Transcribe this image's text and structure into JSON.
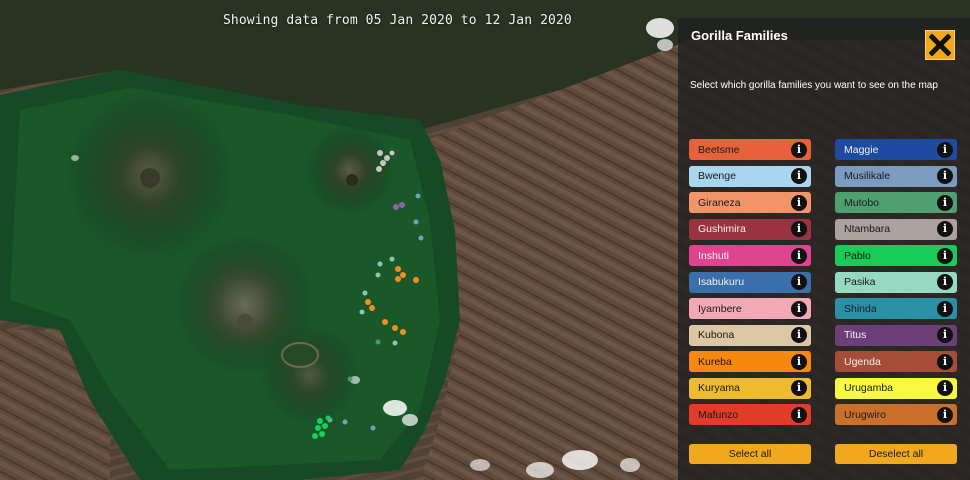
{
  "header": {
    "date_range": "Showing data from 05 Jan 2020 to 12 Jan 2020"
  },
  "panel": {
    "title": "Gorilla Families",
    "close_icon": "close-icon",
    "description": "Select which gorilla families you want to see on the map",
    "families_left": [
      {
        "name": "Beetsme",
        "color": "#e8613c",
        "text_color": "#1a1a1a"
      },
      {
        "name": "Bwenge",
        "color": "#a9d6ef",
        "text_color": "#1a1a1a"
      },
      {
        "name": "Giraneza",
        "color": "#f19468",
        "text_color": "#1a1a1a"
      },
      {
        "name": "Gushimira",
        "color": "#9a3340",
        "text_color": "#f2f2f2"
      },
      {
        "name": "Inshuti",
        "color": "#e04490",
        "text_color": "#f2f2f2"
      },
      {
        "name": "Isabukuru",
        "color": "#3a6fab",
        "text_color": "#f2f2f2"
      },
      {
        "name": "Iyambere",
        "color": "#f2a9b4",
        "text_color": "#1a1a1a"
      },
      {
        "name": "Kubona",
        "color": "#dcc6a3",
        "text_color": "#1a1a1a"
      },
      {
        "name": "Kureba",
        "color": "#f88710",
        "text_color": "#1a1a1a"
      },
      {
        "name": "Kuryama",
        "color": "#eebb30",
        "text_color": "#1a1a1a"
      },
      {
        "name": "Mafunzo",
        "color": "#e23b28",
        "text_color": "#1a1a1a"
      }
    ],
    "families_right": [
      {
        "name": "Maggie",
        "color": "#1e4aa0",
        "text_color": "#f2f2f2"
      },
      {
        "name": "Musilikale",
        "color": "#7c9bc0",
        "text_color": "#1a1a1a"
      },
      {
        "name": "Mutobo",
        "color": "#4fa06e",
        "text_color": "#1a1a1a"
      },
      {
        "name": "Ntambara",
        "color": "#aba2a0",
        "text_color": "#1a1a1a"
      },
      {
        "name": "Pablo",
        "color": "#18cc55",
        "text_color": "#1a1a1a"
      },
      {
        "name": "Pasika",
        "color": "#95d9c2",
        "text_color": "#1a1a1a"
      },
      {
        "name": "Shinda",
        "color": "#2a90a6",
        "text_color": "#1a1a1a"
      },
      {
        "name": "Titus",
        "color": "#6d3f79",
        "text_color": "#f2f2f2"
      },
      {
        "name": "Ugenda",
        "color": "#a64d38",
        "text_color": "#f2f2f2"
      },
      {
        "name": "Urugamba",
        "color": "#f8f840",
        "text_color": "#1a1a1a"
      },
      {
        "name": "Urugwiro",
        "color": "#c8702c",
        "text_color": "#1a1a1a"
      }
    ],
    "info_icon": "info-icon",
    "select_all_label": "Select all",
    "deselect_all_label": "Deselect all"
  },
  "map": {
    "sightings": [
      {
        "family": "Ntambara",
        "color": "#c9c4c0"
      },
      {
        "family": "Titus",
        "color": "#8f63a6"
      },
      {
        "family": "Kureba",
        "color": "#f08e1c"
      },
      {
        "family": "Pasika",
        "color": "#86c9b0"
      },
      {
        "family": "Mutobo",
        "color": "#4a9a68"
      },
      {
        "family": "Musilikale",
        "color": "#7d9cc2"
      },
      {
        "family": "Pablo",
        "color": "#18d05a"
      }
    ]
  }
}
